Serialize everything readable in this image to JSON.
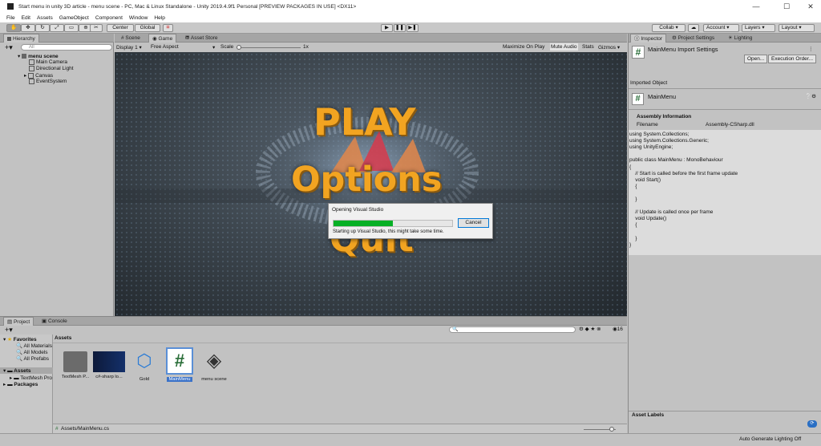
{
  "window": {
    "title": "Start menu in unity 3D article - menu scene - PC, Mac & Linux Standalone - Unity 2019.4.9f1 Personal [PREVIEW PACKAGES IN USE] <DX11>",
    "min": "—",
    "max": "☐",
    "close": "✕"
  },
  "menu": [
    "File",
    "Edit",
    "Assets",
    "GameObject",
    "Component",
    "Window",
    "Help"
  ],
  "toolbar": {
    "center": "Center",
    "global": "Global",
    "collab": "Collab ▾",
    "account": "Account",
    "layers": "Layers",
    "layout": "Layout"
  },
  "hierarchy": {
    "tab": "Hierarchy",
    "search_placeholder": "All",
    "scene": "menu scene",
    "items": [
      "Main Camera",
      "Directional Light",
      "Canvas",
      "EventSystem"
    ]
  },
  "center": {
    "tabs": [
      "Scene",
      "Game",
      "Asset Store"
    ],
    "display": "Display 1",
    "aspect": "Free Aspect",
    "scale_label": "Scale",
    "scale_value": "1x",
    "buttons": [
      "Maximize On Play",
      "Mute Audio",
      "Stats",
      "Gizmos"
    ]
  },
  "game": {
    "play": "PLAY",
    "options": "Options",
    "quit": "Quit"
  },
  "dialog": {
    "title": "Opening Visual Studio",
    "message": "Starting up Visual Studio, this might take some time.",
    "cancel": "Cancel",
    "progress": 0.5
  },
  "inspector": {
    "tabs": [
      "Inspector",
      "Project Settings",
      "Lighting"
    ],
    "title": "MainMenu Import Settings",
    "open": "Open...",
    "execution": "Execution Order...",
    "imported_object": "Imported Object",
    "object_name": "MainMenu",
    "assembly_header": "Assembly Information",
    "filename_label": "Filename",
    "filename_value": "Assembly-CSharp.dll",
    "asset_labels": "Asset Labels"
  },
  "code": [
    "using System.Collections;",
    "using System.Collections.Generic;",
    "using UnityEngine;",
    "",
    "public class MainMenu : MonoBehaviour",
    "{",
    "    // Start is called before the first frame update",
    "    void Start()",
    "    {",
    "",
    "    }",
    "",
    "    // Update is called once per frame",
    "    void Update()",
    "    {",
    "",
    "    }",
    "}"
  ],
  "project": {
    "tabs": [
      "Project",
      "Console"
    ],
    "favorites_label": "Favorites",
    "favorites": [
      "All Materials",
      "All Models",
      "All Prefabs"
    ],
    "assets_label": "Assets",
    "asset_children": [
      "TextMesh Pro"
    ],
    "packages_label": "Packages",
    "assets_header": "Assets",
    "count": "16",
    "path": "Assets/MainMenu.cs",
    "assets": [
      "TextMesh P...",
      "c#-sharp lo...",
      "Gold",
      "MainMenu",
      "menu scene"
    ]
  },
  "status": {
    "text": "Auto Generate Lighting Off"
  }
}
